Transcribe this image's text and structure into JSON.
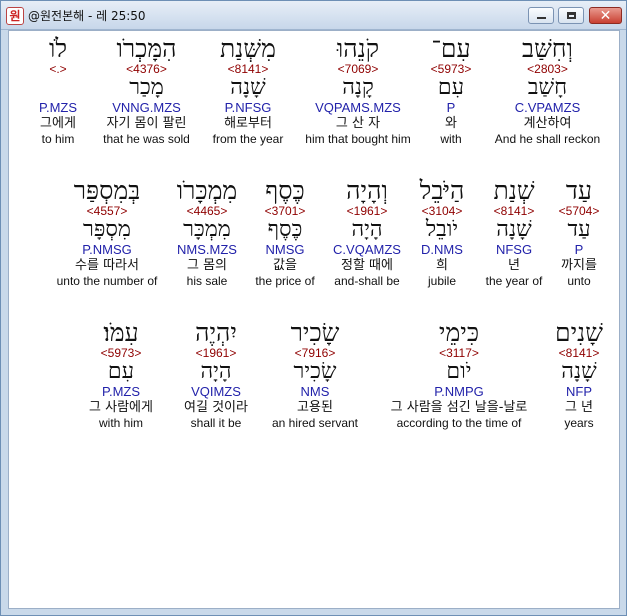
{
  "window": {
    "title": "@원전본해 - 레 25:50",
    "app_icon": "원",
    "minimize": "",
    "maximize": "",
    "close": "✕"
  },
  "rows": [
    {
      "words": [
        {
          "heb": "לֹו",
          "strong": "<.>",
          "lemma": "",
          "morph": "P.MZS",
          "ko": "그에게",
          "en": "to him"
        },
        {
          "heb": "הִמָּכְרֹו",
          "strong": "<4376>",
          "lemma": "מָכַר",
          "morph": "VNNG.MZS",
          "ko": "자기 몸이 팔린",
          "en": "that he was sold"
        },
        {
          "heb": "מִשְּׁנַת",
          "strong": "<8141>",
          "lemma": "שָׁנָה",
          "morph": "P.NFSG",
          "ko": "해로부터",
          "en": "from the year"
        },
        {
          "heb": "קֹנֵהוּ",
          "strong": "<7069>",
          "lemma": "קָנָה",
          "morph": "VQPAMS.MZS",
          "ko": "그 산 자",
          "en": "him that bought him"
        },
        {
          "heb": "עִם־",
          "strong": "<5973>",
          "lemma": "עִם",
          "morph": "P",
          "ko": "와",
          "en": "with"
        },
        {
          "heb": "וְחִשַּׁב",
          "strong": "<2803>",
          "lemma": "חָשַׁב",
          "morph": "C.VPAMZS",
          "ko": "계산하여",
          "en": "And he shall reckon"
        }
      ]
    },
    {
      "words": [
        {
          "heb": "בְּמִסְפַּר",
          "strong": "<4557>",
          "lemma": "מִסְפָּר",
          "morph": "P.NMSG",
          "ko": "수를 따라서",
          "en": "unto the number of"
        },
        {
          "heb": "מִמְכָּרֹו",
          "strong": "<4465>",
          "lemma": "מִמְכָּר",
          "morph": "NMS.MZS",
          "ko": "그 몸의",
          "en": "his sale"
        },
        {
          "heb": "כֶּסֶף",
          "strong": "<3701>",
          "lemma": "כֶּסֶף",
          "morph": "NMSG",
          "ko": "값을",
          "en": "the price of"
        },
        {
          "heb": "וְהָיָה",
          "strong": "<1961>",
          "lemma": "הָיָה",
          "morph": "C.VQAMZS",
          "ko": "정할 때에",
          "en": "and-shall be"
        },
        {
          "heb": "הַיֹּבֵל",
          "strong": "<3104>",
          "lemma": "יֹובֵל",
          "morph": "D.NMS",
          "ko": "희",
          "en": "jubile"
        },
        {
          "heb": "שְׁנַת",
          "strong": "<8141>",
          "lemma": "שָׁנָה",
          "morph": "NFSG",
          "ko": "년",
          "en": "the year of"
        },
        {
          "heb": "עַד",
          "strong": "<5704>",
          "lemma": "עַד",
          "morph": "P",
          "ko": "까지를",
          "en": "unto"
        }
      ]
    },
    {
      "words": [
        {
          "heb": "עִמֹּו׃",
          "strong": "<5973>",
          "lemma": "עִם",
          "morph": "P.MZS",
          "ko": "그 사람에게",
          "en": "with him"
        },
        {
          "heb": "יִהְיֶה",
          "strong": "<1961>",
          "lemma": "הָיָה",
          "morph": "VQIMZS",
          "ko": "여길 것이라",
          "en": "shall it be"
        },
        {
          "heb": "שָׂכִיר",
          "strong": "<7916>",
          "lemma": "שָׂכִיר",
          "morph": "NMS",
          "ko": "고용된",
          "en": "an hired servant"
        },
        {
          "heb": "כִּימֵי",
          "strong": "<3117>",
          "lemma": "יֹום",
          "morph": "P.NMPG",
          "ko": "그 사람을 섬긴 날을-날로",
          "en": "according to the time of"
        },
        {
          "heb": "שָׁנִים",
          "strong": "<8141>",
          "lemma": "שָׁנָה",
          "morph": "NFP",
          "ko": "그 년",
          "en": "years"
        }
      ]
    }
  ]
}
